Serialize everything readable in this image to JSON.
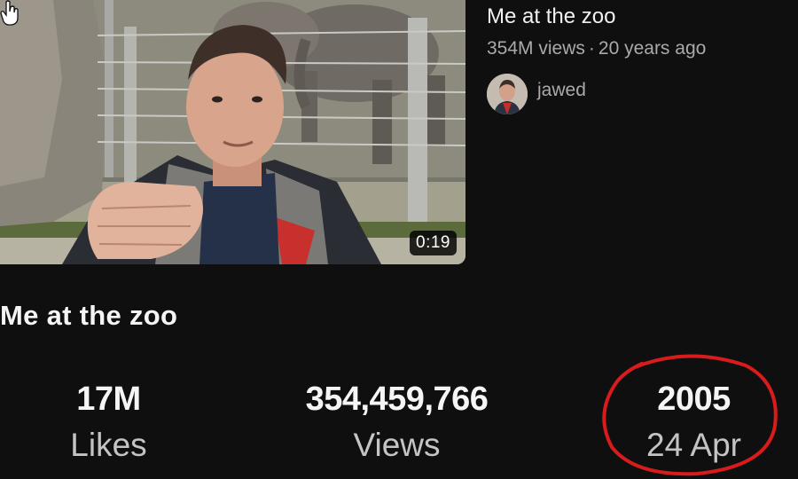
{
  "thumbnail": {
    "duration": "0:19"
  },
  "video": {
    "title": "Me at the zoo",
    "views_short": "354M views",
    "separator": "·",
    "age": "20 years ago"
  },
  "channel": {
    "name": "jawed"
  },
  "overlay": {
    "title": "Me at the zoo",
    "stats": {
      "likes": {
        "value": "17M",
        "label": "Likes"
      },
      "views": {
        "value": "354,459,766",
        "label": "Views"
      },
      "date": {
        "value": "2005",
        "label": "24 Apr"
      }
    }
  },
  "colors": {
    "background": "#0f0f0f",
    "secondary_text": "#aaaaaa",
    "annotation_circle": "#d81b1b"
  }
}
